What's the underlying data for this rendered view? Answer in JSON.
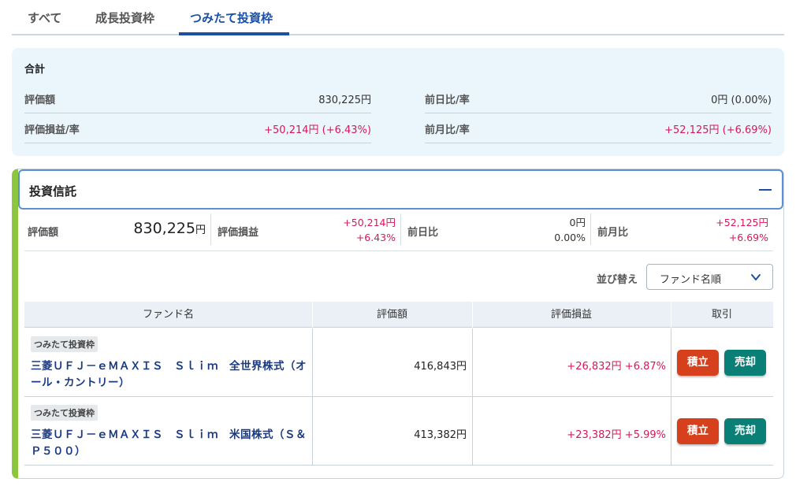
{
  "tabs": [
    {
      "label": "すべて"
    },
    {
      "label": "成長投資枠"
    },
    {
      "label": "つみたて投資枠",
      "active": true
    }
  ],
  "summary": {
    "title": "合計",
    "valuation_label": "評価額",
    "valuation_value": "830,225円",
    "pl_label": "評価損益/率",
    "pl_value": "+50,214円 (+6.43%)",
    "day_label": "前日比/率",
    "day_value": "0円 (0.00%)",
    "month_label": "前月比/率",
    "month_value": "+52,125円 (+6.69%)"
  },
  "card": {
    "title": "投資信託",
    "metrics": {
      "valuation_label": "評価額",
      "valuation_number": "830,225",
      "valuation_unit": "円",
      "pl_label": "評価損益",
      "pl_amount": "+50,214円",
      "pl_rate": "+6.43%",
      "day_label": "前日比",
      "day_amount": "0円",
      "day_rate": "0.00%",
      "month_label": "前月比",
      "month_amount": "+52,125円",
      "month_rate": "+6.69%"
    },
    "sort": {
      "label": "並び替え",
      "selected": "ファンド名順"
    },
    "table": {
      "headers": [
        "ファンド名",
        "評価額",
        "評価損益",
        "取引"
      ],
      "rows": [
        {
          "badge": "つみたて投資枠",
          "name": "三菱ＵＦＪ－ｅＭＡＸＩＳ　Ｓｌｉｍ　全世界株式（オール・カントリー）",
          "amount": "416,843円",
          "pl": "+26,832円  +6.87%",
          "buy_label": "積立",
          "sell_label": "売却"
        },
        {
          "badge": "つみたて投資枠",
          "name": "三菱ＵＦＪ－ｅＭＡＸＩＳ　Ｓｌｉｍ　米国株式（Ｓ＆Ｐ５００）",
          "amount": "413,382円",
          "pl": "+23,382円  +5.99%",
          "buy_label": "積立",
          "sell_label": "売却"
        }
      ]
    }
  },
  "colors": {
    "accent": "#1a4fa3",
    "positive": "#d6195a",
    "buy_button": "#d6401c",
    "sell_button": "#0a7f75",
    "card_stripe": "#8cc63f"
  },
  "icons": {
    "collapse": "minus-icon",
    "dropdown": "chevron-down-icon"
  }
}
